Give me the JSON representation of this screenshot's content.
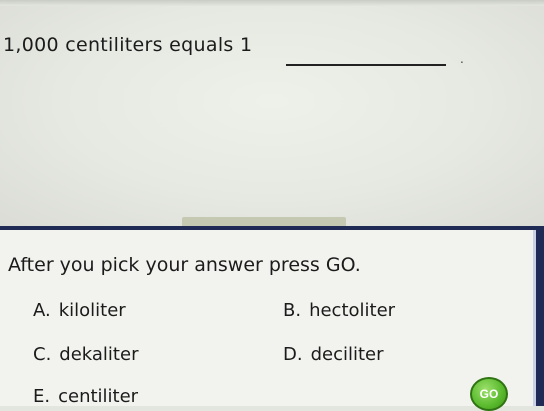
{
  "question": {
    "text": "1,000 centiliters equals 1",
    "punctuation": "."
  },
  "answer_panel": {
    "instruction": "After you pick your answer press GO.",
    "choices": [
      {
        "letter": "A.",
        "label": "kiloliter"
      },
      {
        "letter": "B.",
        "label": "hectoliter"
      },
      {
        "letter": "C.",
        "label": "dekaliter"
      },
      {
        "letter": "D.",
        "label": "deciliter"
      },
      {
        "letter": "E.",
        "label": "centiliter"
      }
    ],
    "go_label": "GO"
  },
  "colors": {
    "panel_border": "#1f2a55",
    "go_button": "#58b92c",
    "background": "#e3e6df"
  },
  "icons": {
    "go": "go-circle-button"
  }
}
